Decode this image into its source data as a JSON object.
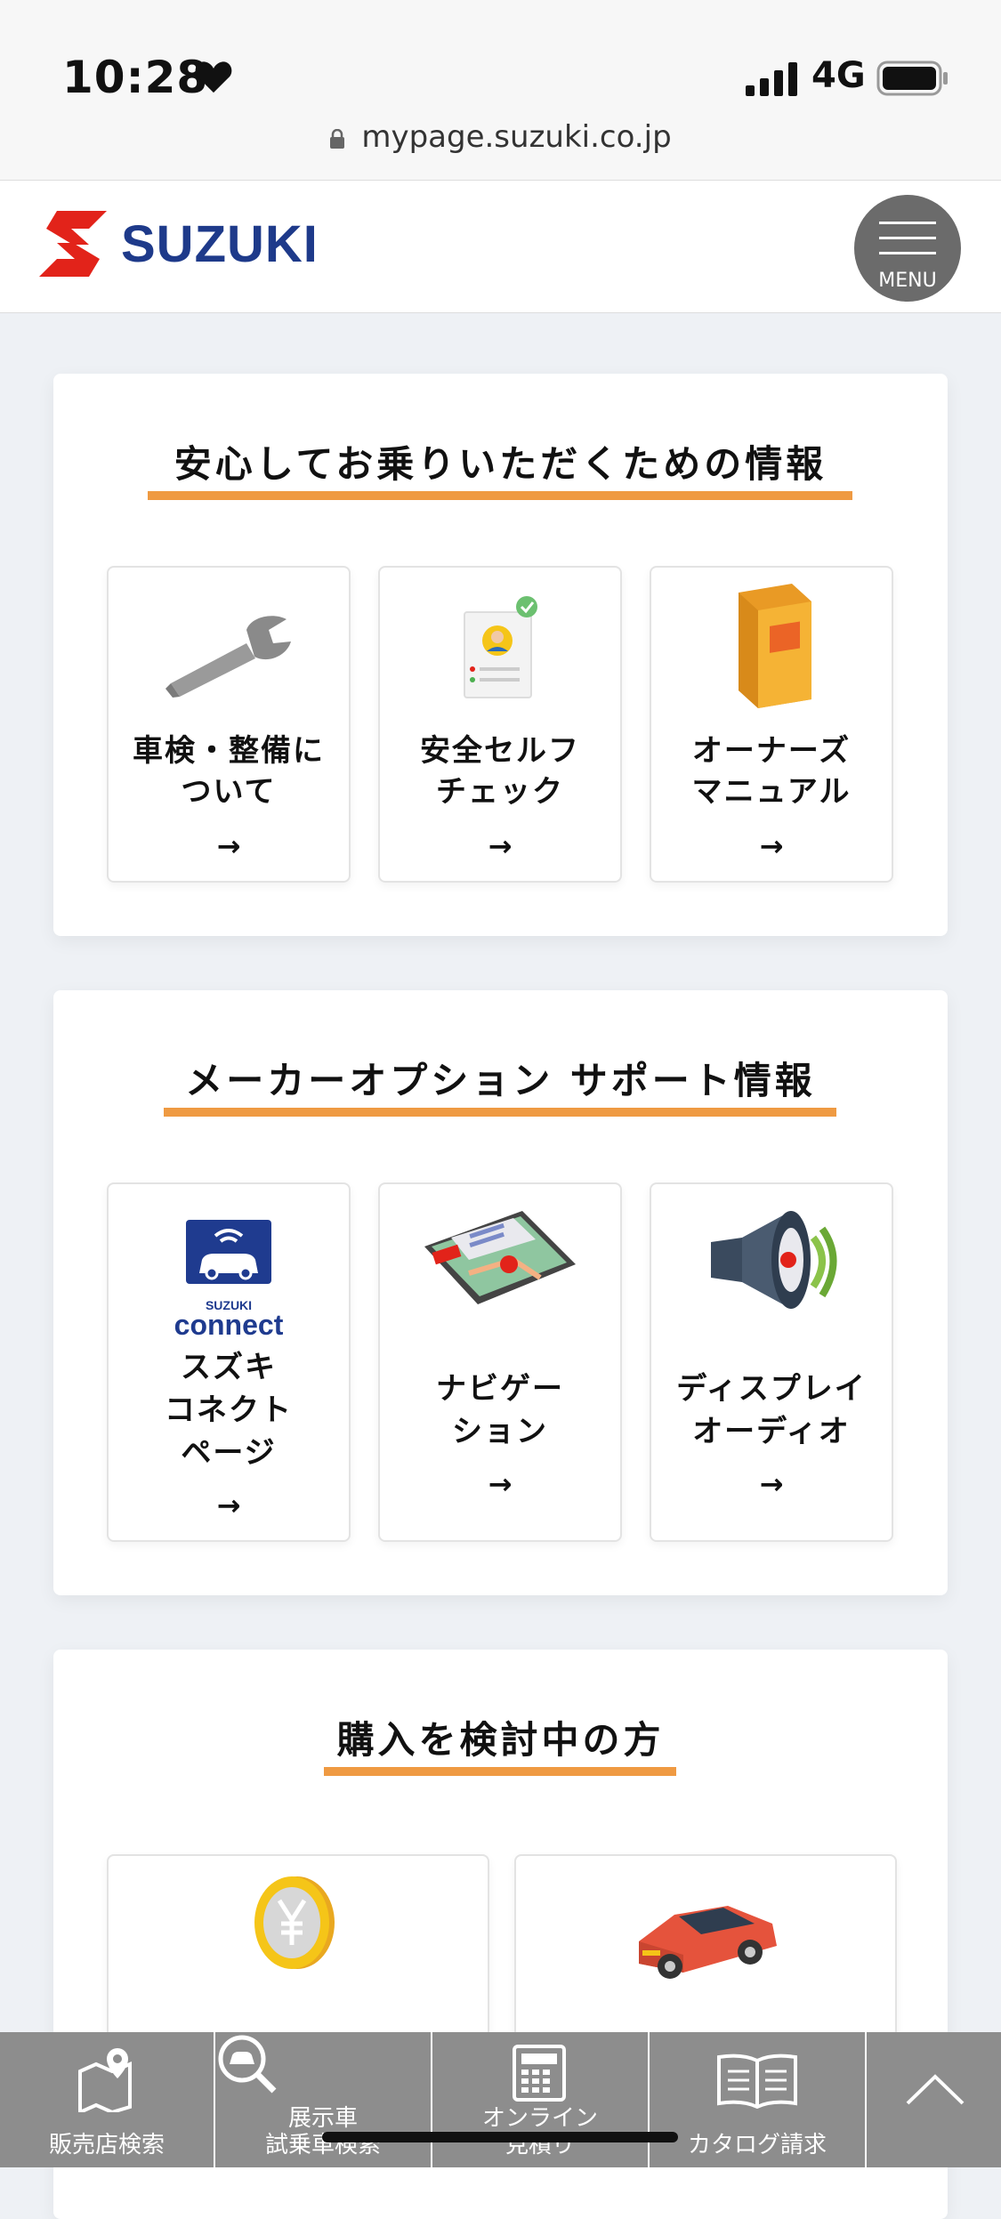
{
  "status_bar": {
    "time": "10:28",
    "network": "4G"
  },
  "browser": {
    "url": "mypage.suzuki.co.jp"
  },
  "header": {
    "logo_text": "SUZUKI",
    "menu_label": "MENU"
  },
  "sections": [
    {
      "title": "安心してお乗りいただくための情報",
      "tiles": [
        {
          "line1": "車検・整備に",
          "line2": "ついて",
          "icon": "wrench-icon"
        },
        {
          "line1": "安全セルフ",
          "line2": "チェック",
          "icon": "checklist-icon"
        },
        {
          "line1": "オーナーズ",
          "line2": "マニュアル",
          "icon": "book-icon"
        }
      ]
    },
    {
      "title": "メーカーオプション サポート情報",
      "tiles": [
        {
          "line1": "スズキ",
          "line2": "コネクト",
          "line3": "ページ",
          "icon": "suzuki-connect-icon",
          "logo_small": "SUZUKI",
          "logo_big": "connect"
        },
        {
          "line1": "ナビゲー",
          "line2": "ション",
          "icon": "navigation-tablet-icon"
        },
        {
          "line1": "ディスプレイ",
          "line2": "オーディオ",
          "icon": "speaker-icon"
        }
      ]
    },
    {
      "title": "購入を検討中の方",
      "tiles": [
        {
          "icon": "yen-coin-icon"
        },
        {
          "icon": "red-car-icon"
        }
      ]
    }
  ],
  "bottom_nav": [
    {
      "label": "販売店検索",
      "icon": "map-pin-icon"
    },
    {
      "line1": "展示車",
      "line2": "試乗車検索",
      "icon": "car-search-icon"
    },
    {
      "line1": "オンライン",
      "line2": "見積り",
      "icon": "calculator-icon"
    },
    {
      "label": "カタログ請求",
      "icon": "catalog-book-icon"
    },
    {
      "icon": "chevron-up-icon"
    }
  ],
  "arrow_glyph": "→"
}
